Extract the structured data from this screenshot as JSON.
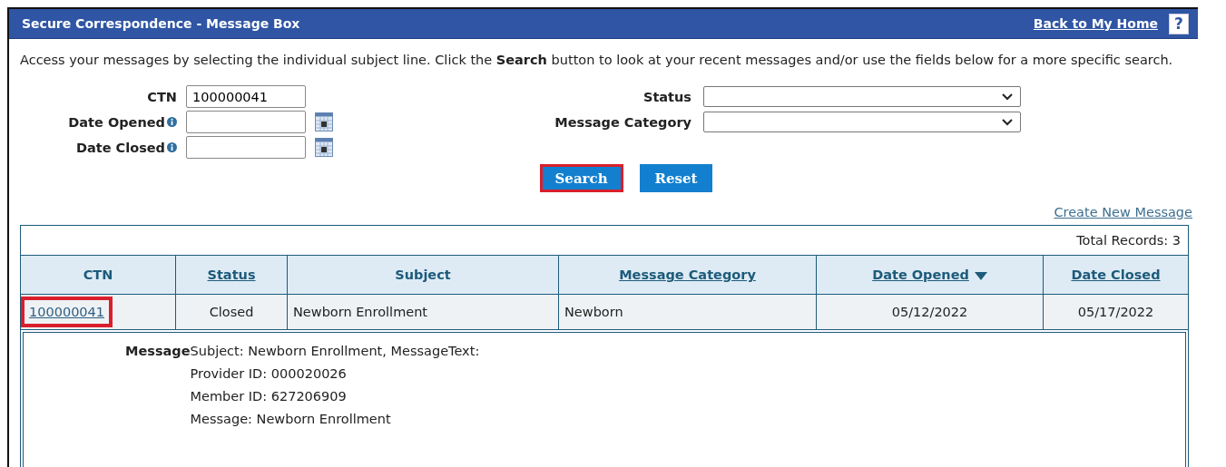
{
  "header": {
    "title": "Secure Correspondence - Message Box",
    "home_link": "Back to My Home",
    "help": "?"
  },
  "intro": "Access your messages by selecting the individual subject line. Click the **Search** button to look at your recent messages and/or use the fields below for a more specific search.",
  "filters_left": [
    {
      "label": "CTN",
      "kind": "text",
      "info": false,
      "value": "100000041"
    },
    {
      "label": "Date Opened",
      "kind": "date",
      "info": true
    },
    {
      "label": "Date Closed",
      "kind": "date",
      "info": true
    }
  ],
  "filters_right": [
    {
      "label": "Status",
      "kind": "select"
    },
    {
      "label": "Message Category",
      "kind": "select"
    }
  ],
  "buttons": [
    {
      "label": "Search",
      "highlighted": true
    },
    {
      "label": "Reset",
      "highlighted": false
    }
  ],
  "create_link": "Create New Message",
  "table": {
    "total": "Total Records: 3",
    "columns": [
      {
        "label": "CTN",
        "sortable": false,
        "sorted": false
      },
      {
        "label": "Status",
        "sortable": true,
        "sorted": false
      },
      {
        "label": "Subject",
        "sortable": false,
        "sorted": false
      },
      {
        "label": "Message Category",
        "sortable": true,
        "sorted": false
      },
      {
        "label": "Date Opened",
        "sortable": true,
        "sorted": true
      },
      {
        "label": "Date Closed",
        "sortable": true,
        "sorted": false
      }
    ],
    "rows": [
      {
        "expanded": true,
        "cells": [
          {
            "text": "100000041",
            "kind": "link",
            "highlighted": true
          },
          {
            "text": "Closed",
            "kind": "text"
          },
          {
            "text": "Newborn Enrollment",
            "kind": "text"
          },
          {
            "text": "Newborn",
            "kind": "text"
          },
          {
            "text": "05/12/2022",
            "kind": "text"
          },
          {
            "text": "05/17/2022",
            "kind": "text"
          }
        ],
        "detail": {
          "label": "Message",
          "lines": [
            "Subject: Newborn Enrollment, MessageText:",
            "Provider ID: 000020026",
            "Member ID: 627206909",
            "Message: Newborn Enrollment"
          ]
        }
      }
    ]
  }
}
